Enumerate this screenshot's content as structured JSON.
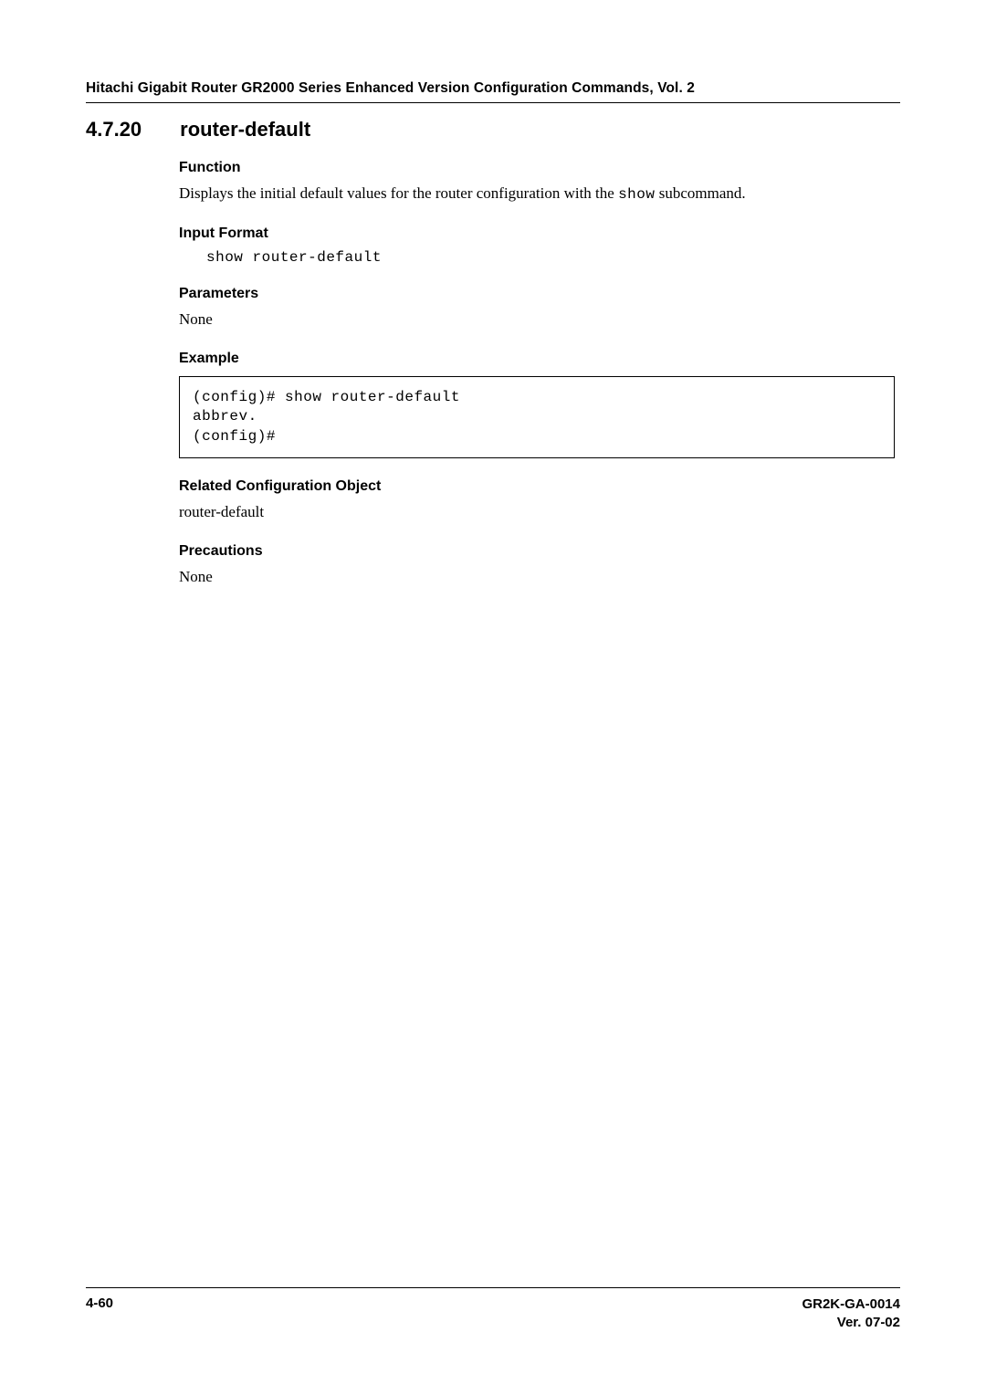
{
  "header": {
    "running": "Hitachi Gigabit Router GR2000 Series Enhanced Version Configuration Commands, Vol. 2"
  },
  "section": {
    "number": "4.7.20",
    "title": "router-default"
  },
  "subheads": {
    "function": "Function",
    "inputFormat": "Input Format",
    "parameters": "Parameters",
    "example": "Example",
    "related": "Related Configuration Object",
    "precautions": "Precautions"
  },
  "body": {
    "function_pre": "Displays the initial default values for the router configuration with the ",
    "function_mono": "show",
    "function_post": " subcommand.",
    "inputFormat": "show router-default",
    "parameters": "None",
    "exampleBlock": "(config)# show router-default\nabbrev.\n(config)#",
    "related": "router-default",
    "precautions": "None"
  },
  "footer": {
    "left": "4-60",
    "right1": "GR2K-GA-0014",
    "right2": "Ver. 07-02"
  }
}
